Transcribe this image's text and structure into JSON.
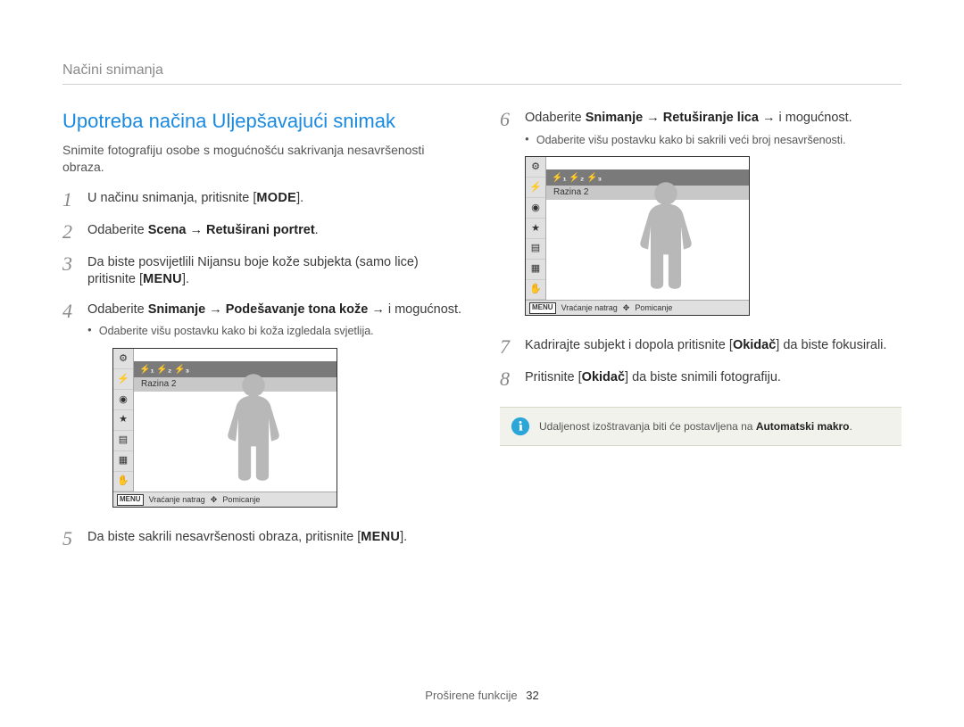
{
  "header": {
    "breadcrumb": "Načini snimanja"
  },
  "left": {
    "title": "Upotreba načina Uljepšavajući snimak",
    "intro": "Snimite fotografiju osobe s mogućnošću sakrivanja nesavršenosti obraza.",
    "steps": {
      "s1_a": "U načinu snimanja, pritisnite [",
      "s1_key": "MODE",
      "s1_b": "].",
      "s2_a": "Odaberite ",
      "s2_b": "Scena → Retuširani portret",
      "s2_c": ".",
      "s3_a": "Da biste posvijetlili Nijansu boje kože subjekta (samo lice) pritisnite [",
      "s3_key": "MENU",
      "s3_b": "].",
      "s4_a": "Odaberite ",
      "s4_b": "Snimanje → Podešavanje tona kože →",
      "s4_c": " i mogućnost.",
      "s4_bullet": "Odaberite višu postavku kako bi koža izgledala svjetlija.",
      "s5_a": "Da biste sakrili nesavršenosti obraza, pritisnite [",
      "s5_key": "MENU",
      "s5_b": "]."
    }
  },
  "right": {
    "steps": {
      "s6_a": "Odaberite ",
      "s6_b": "Snimanje → Retuširanje lica →",
      "s6_c": " i mogućnost.",
      "s6_bullet": "Odaberite višu postavku kako bi sakrili veći broj nesavršenosti.",
      "s7_a": "Kadrirajte subjekt i dopola pritisnite [",
      "s7_key": "Okidač",
      "s7_b": "] da biste fokusirali.",
      "s8_a": "Pritisnite [",
      "s8_key": "Okidač",
      "s8_b": "] da biste snimili fotografiju."
    },
    "note_a": "Udaljenost izoštravanja biti će postavljena na ",
    "note_b": "Automatski makro",
    "note_c": "."
  },
  "lcd": {
    "level_icons": "⚡₁  ⚡₂  ⚡₃",
    "level_sel": "Razina 2",
    "menu": "MENU",
    "back": "Vraćanje natrag",
    "move_icon": "✥",
    "move": "Pomicanje",
    "side_icons": [
      "⚙",
      "⚡",
      "◉",
      "★",
      "▤",
      "▦",
      "✋"
    ]
  },
  "footer": {
    "section": "Proširene funkcije",
    "page": "32"
  }
}
